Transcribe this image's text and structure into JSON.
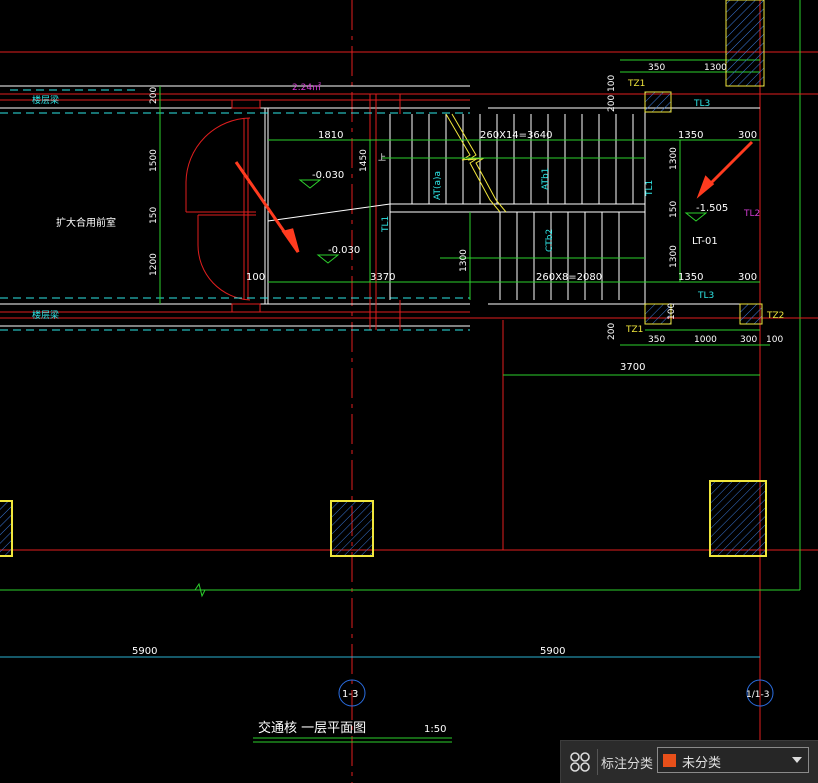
{
  "colors": {
    "background": "#000000",
    "axis_red": "#e01e1e",
    "wall_white": "#ffffff",
    "dim_green": "#2dd12d",
    "text_cyan": "#2ee6e6",
    "magenta": "#d23cd2",
    "yellow": "#f0e63c",
    "blue_axis": "#2a6de0",
    "arrow": "#ff3b1f"
  },
  "drawing": {
    "beam_label_top": "楼层梁",
    "beam_label_bottom": "楼层梁",
    "area_label": "2.24㎡",
    "room_name": "扩大合用前室",
    "dim_200_top": "200",
    "dim_1500": "1500",
    "dim_150_left": "150",
    "dim_1200": "1200",
    "dim_1810": "1810",
    "dim_1450": "1450",
    "dim_stair_top": "260X14=3640",
    "dim_1350_top": "1350",
    "dim_300_top": "300",
    "dim_1300_a": "1300",
    "dim_150_right": "150",
    "dim_1300_b": "1300",
    "dim_100_left": "100",
    "dim_3370": "3370",
    "dim_1300_mid": "1300",
    "dim_stair_bottom": "260X8=2080",
    "dim_1350_bottom": "1350",
    "dim_300_bottom": "300",
    "dim_350_top": "350",
    "dim_1300_topright": "1300",
    "dim_100_a": "100",
    "dim_200_b": "200",
    "dim_200_c": "200",
    "dim_100_b": "100",
    "dim_350_bottom": "350",
    "dim_1000": "1000",
    "dim_300_br": "300",
    "dim_100_br": "100",
    "dim_3700": "3700",
    "dim_5900_left": "5900",
    "dim_5900_right": "5900",
    "level_left_1": "-0.030",
    "level_left_2": "-0.030",
    "level_right": "-1.505",
    "stair_label": "LT-01",
    "tz1_top": "TZ1",
    "tz1_bottom": "TZ1",
    "tz2": "TZ2",
    "tl3_top": "TL3",
    "tl3_bottom": "TL3",
    "tl2": "TL2",
    "tl1_a": "TL1",
    "tl1_b": "TL1",
    "atb_a": "AT(a)a",
    "atb_b": "ATb1",
    "ctb": "CTb2",
    "up_mark": "上",
    "axis_1": "1-3",
    "axis_2": "1/1-3",
    "title": "交通核 一层平面图",
    "scale": "1:50"
  },
  "annotation_bar": {
    "icon": "grid-four-icon",
    "label": "标注分类",
    "selected": "未分类",
    "swatch_color": "#e8501a"
  }
}
